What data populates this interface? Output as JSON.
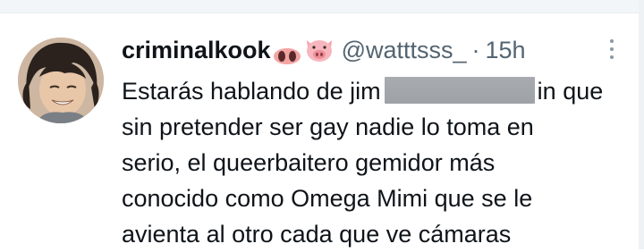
{
  "tweet": {
    "display_name": "criminalkook",
    "emoji_icons": [
      "pig-nose-icon",
      "pig-face-icon"
    ],
    "handle": "@watttsss_",
    "separator": "·",
    "timestamp": "15h",
    "text_lines": {
      "l1_before": "Estarás hablando de jim",
      "l1_after": "in que",
      "l2": "sin pretender ser gay nadie lo toma en",
      "l3": "serio, el queerbaitero gemidor más",
      "l4": "conocido como Omega Mimi que se le",
      "l5": "avienta al otro cada que ve cámaras"
    }
  },
  "colors": {
    "text_primary": "#0f1419",
    "text_secondary": "#536471",
    "redaction": "#a3a7ac"
  }
}
